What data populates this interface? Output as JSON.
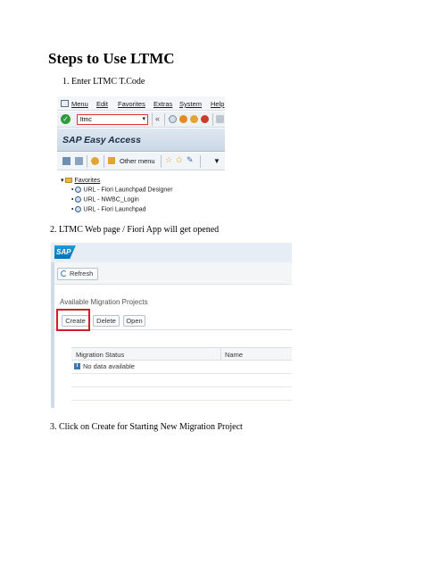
{
  "doc": {
    "title": "Steps to Use LTMC",
    "step1": "1.   Enter LTMC T.Code",
    "step2": "2. LTMC Web page / Fiori App will get opened",
    "step3": "3. Click on Create for Starting New Migration Project"
  },
  "sapgui": {
    "menu": [
      "Menu",
      "Edit",
      "Favorites",
      "Extras",
      "System",
      "Help"
    ],
    "tcode_value": "ltmc",
    "header_title": "SAP Easy Access",
    "other_menu": "Other menu",
    "favorites_label": "Favorites",
    "favorites": [
      "URL - Fiori Launchpad Designer",
      "URL - NWBC_Login",
      "URL - Fiori Launchpad"
    ]
  },
  "fiori": {
    "logo": "SAP",
    "refresh_label": "Refresh",
    "section_title": "Available Migration Projects",
    "buttons": [
      "Create",
      "Delete",
      "Open"
    ],
    "columns": [
      "Migration Status",
      "Name"
    ],
    "no_data": "No data available"
  },
  "colors": {
    "highlight": "#d11c2b",
    "sap_blue": "#0a6fb4"
  }
}
